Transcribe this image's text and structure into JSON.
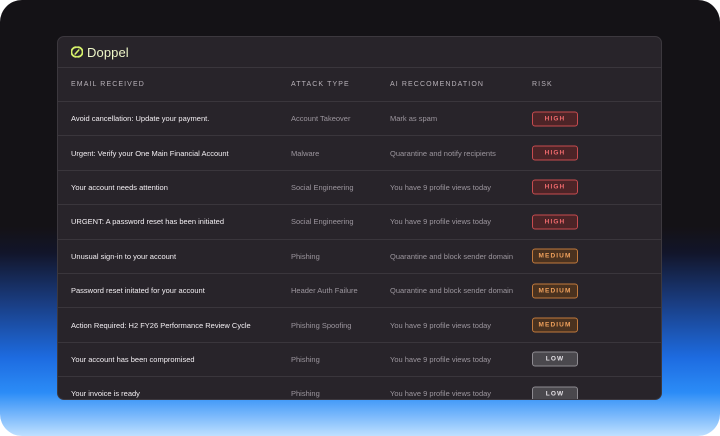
{
  "brand": {
    "name": "Doppel"
  },
  "table": {
    "headers": {
      "email": "EMAIL RECEIVED",
      "attack": "ATTACK TYPE",
      "ai": "AI RECCOMENDATION",
      "risk": "RISK"
    },
    "rows": [
      {
        "email": "Avoid cancellation: Update your payment.",
        "attack": "Account Takeover",
        "ai": "Mark as spam",
        "risk": "HIGH",
        "level": "high"
      },
      {
        "email": "Urgent: Verify your One Main Financial Account",
        "attack": "Malware",
        "ai": "Quarantine and notify recipients",
        "risk": "HIGH",
        "level": "high"
      },
      {
        "email": "Your account needs attention",
        "attack": "Social Engineering",
        "ai": "You have 9 profile views today",
        "risk": "HIGH",
        "level": "high"
      },
      {
        "email": "URGENT: A password reset has been initiated",
        "attack": "Social Engineering",
        "ai": "You have 9 profile views today",
        "risk": "HIGH",
        "level": "high"
      },
      {
        "email": "Unusual sign-in to your account",
        "attack": "Phishing",
        "ai": "Quarantine and block sender domain",
        "risk": "MEDIUM",
        "level": "medium"
      },
      {
        "email": "Password reset initated for your account",
        "attack": "Header Auth Failure",
        "ai": "Quarantine and block sender domain",
        "risk": "MEDIUM",
        "level": "medium"
      },
      {
        "email": "Action Required: H2 FY26 Performance Review Cycle",
        "attack": "Phishing Spoofing",
        "ai": "You have 9 profile views today",
        "risk": "MEDIUM",
        "level": "medium"
      },
      {
        "email": "Your account has been compromised",
        "attack": "Phishing",
        "ai": "You have 9 profile views today",
        "risk": "LOW",
        "level": "low"
      },
      {
        "email": "Your invoice is ready",
        "attack": "Phishing",
        "ai": "You have 9 profile views today",
        "risk": "LOW",
        "level": "low"
      }
    ]
  },
  "colors": {
    "accent": "#d7f26b",
    "high": "#f06a6d",
    "medium": "#f0a15c",
    "low": "#e2dfe4"
  },
  "icons": {
    "brand": "doppel-logo-icon"
  }
}
